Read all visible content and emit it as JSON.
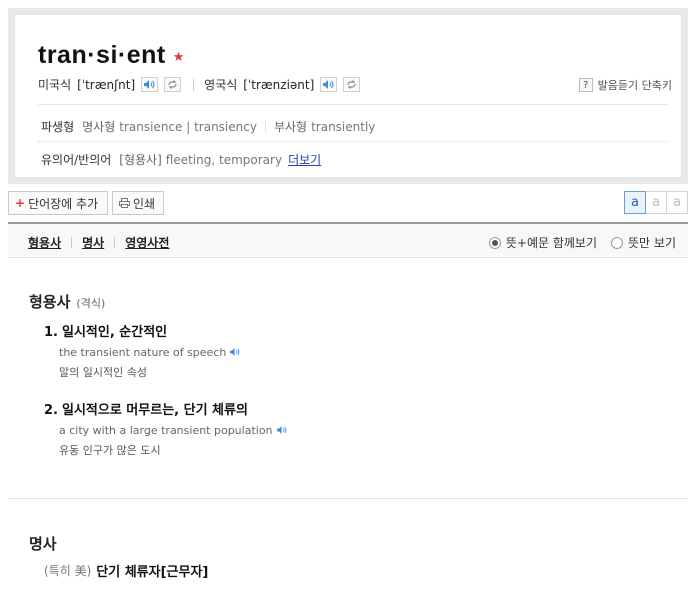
{
  "entry": {
    "word": "tran·si·ent",
    "star": "★",
    "us_label": "미국식",
    "us_pron": "[ˈtrænʃnt]",
    "uk_label": "영국식",
    "uk_pron": "[ˈtrænziənt]",
    "help_badge": "?",
    "help_label": "발음듣기 단축키"
  },
  "derivatives": {
    "label": "파생형",
    "noun_label": "명사형",
    "noun_forms": "transience | transiency",
    "adv_label": "부사형",
    "adv_form": "transiently"
  },
  "synonyms": {
    "label": "유의어/반의어",
    "pos_label": "[형용사]",
    "words": "fleeting, temporary",
    "more_link": "더보기"
  },
  "toolbar": {
    "add_label": "단어장에 추가",
    "add_plus": "+",
    "print_label": "인쇄",
    "font_sizes": [
      "a",
      "a",
      "a"
    ]
  },
  "tabs": {
    "items": [
      "형용사",
      "명사",
      "영영사전"
    ],
    "view_options": [
      "뜻+예문 함께보기",
      "뜻만 보기"
    ]
  },
  "adjective": {
    "title": "형용사",
    "subtitle": "(격식)",
    "senses": [
      {
        "num": "1.",
        "meaning": "일시적인, 순간적인",
        "example_en": "the transient nature of speech",
        "example_ko": "말의 일시적인 속성"
      },
      {
        "num": "2.",
        "meaning": "일시적으로 머무르는, 단기 체류의",
        "example_en": "a city with a large transient population",
        "example_ko": "유동 인구가 많은 도시"
      }
    ]
  },
  "noun": {
    "title": "명사",
    "prefix": "(특히 美)",
    "meaning": "단기 체류자[근무자]"
  },
  "colors": {
    "accent_red": "#e03c3c",
    "link_blue": "#1f44b0",
    "speaker_blue": "#3d8be0"
  }
}
